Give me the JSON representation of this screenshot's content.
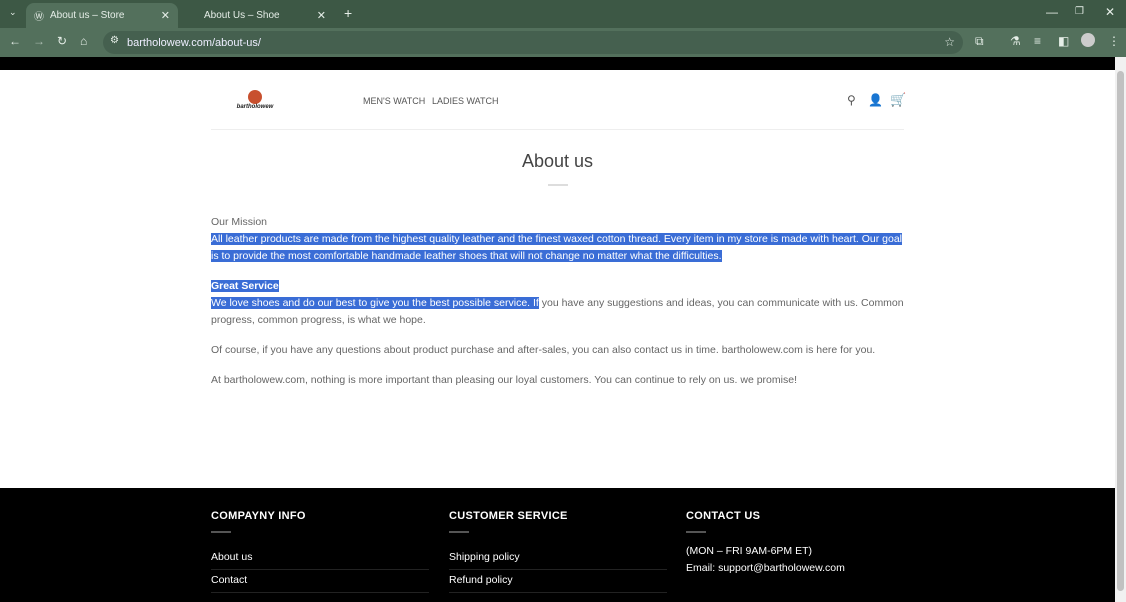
{
  "browser": {
    "tabs": [
      {
        "title": "About us – Store",
        "active": true
      },
      {
        "title": "About Us – Shoe",
        "active": false
      }
    ],
    "url": "bartholowew.com/about-us/"
  },
  "header": {
    "logo_text": "bartholowew",
    "nav": [
      "MEN'S WATCH",
      "LADIES WATCH"
    ]
  },
  "main": {
    "title": "About us",
    "mission_heading": "Our Mission",
    "mission_text": "All leather products are made from the highest quality leather and the finest waxed cotton thread. Every item in my store is made with heart. Our goal is to provide the most comfortable handmade leather shoes that will not change no matter what the difficulties.",
    "service_heading": "Great Service",
    "service_text_selected": "We love shoes and do our best to give you the best possible service. If",
    "service_text_rest": " you have any suggestions and ideas, you can communicate with us. Common progress, common progress, is what we hope.",
    "para3": "Of course, if you have any questions about product purchase and after-sales, you can also contact us in time. bartholowew.com is here for you.",
    "para4": "At bartholowew.com, nothing is more important than pleasing our loyal customers. You can continue to rely on us. we promise!"
  },
  "footer": {
    "company": {
      "heading": "COMPAYNY INFO",
      "links": [
        "About us",
        "Contact"
      ]
    },
    "service": {
      "heading": "CUSTOMER SERVICE",
      "links": [
        "Shipping policy",
        "Refund policy"
      ]
    },
    "contact": {
      "heading": "CONTACT US",
      "hours": "(MON – FRI 9AM-6PM ET)",
      "email": "Email: support@bartholowew.com"
    }
  },
  "colors": {
    "selection": "#3a6dd6",
    "chrome": "#53705c"
  }
}
